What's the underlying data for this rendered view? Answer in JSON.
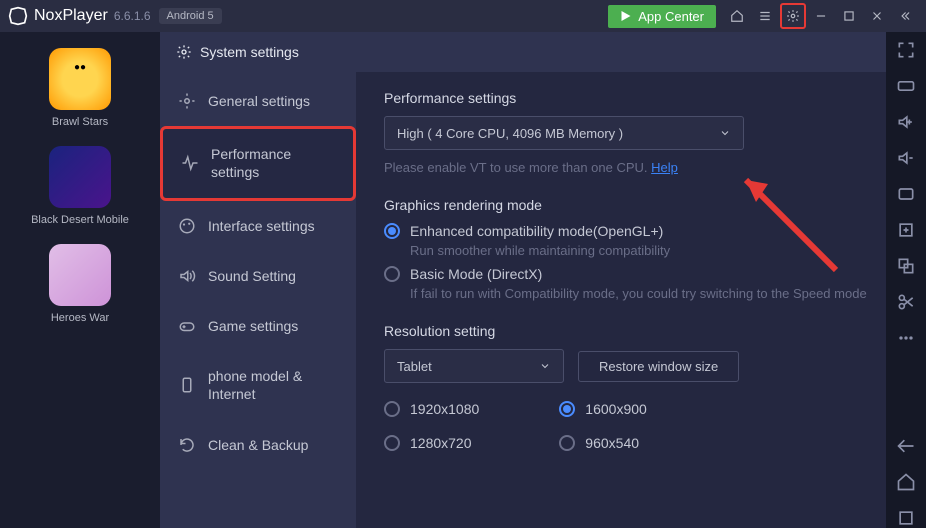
{
  "titlebar": {
    "product": "NoxPlayer",
    "version": "6.6.1.6",
    "android_badge": "Android 5",
    "app_center": "App Center"
  },
  "apps": [
    {
      "label": "Brawl Stars"
    },
    {
      "label": "Black Desert Mobile"
    },
    {
      "label": "Heroes War"
    }
  ],
  "settings": {
    "title": "System settings",
    "sidebar": [
      {
        "label": "General settings"
      },
      {
        "label": "Performance settings"
      },
      {
        "label": "Interface settings"
      },
      {
        "label": "Sound Setting"
      },
      {
        "label": "Game settings"
      },
      {
        "label": "phone model & Internet"
      },
      {
        "label": "Clean & Backup"
      }
    ],
    "performance": {
      "title": "Performance settings",
      "dropdown_value": "High ( 4 Core CPU, 4096 MB Memory )",
      "hint_pre": "Please enable VT to use more than one CPU. ",
      "hint_link": "Help"
    },
    "graphics": {
      "title": "Graphics rendering mode",
      "opt1": "Enhanced compatibility mode(OpenGL+)",
      "opt1_sub": "Run smoother while maintaining compatibility",
      "opt2": "Basic Mode (DirectX)",
      "opt2_sub": "If fail to run with Compatibility mode, you could try switching to the Speed mode"
    },
    "resolution": {
      "title": "Resolution setting",
      "dropdown_value": "Tablet",
      "restore_btn": "Restore window size",
      "r1": "1920x1080",
      "r2": "1600x900",
      "r3": "1280x720",
      "r4": "960x540"
    }
  }
}
